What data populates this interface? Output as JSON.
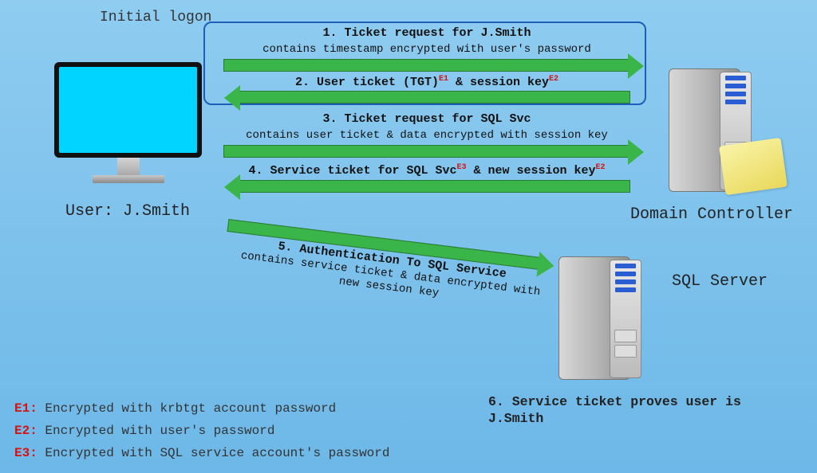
{
  "initialLogon": "Initial logon",
  "user": {
    "label": "User: J.Smith"
  },
  "dc": {
    "label": "Domain Controller"
  },
  "sql": {
    "label": "SQL Server"
  },
  "steps": {
    "s1": {
      "title": "1. Ticket request for J.Smith",
      "sub": "contains timestamp encrypted with user's password"
    },
    "s2": {
      "pre": "2. User ticket (TGT)",
      "sup1": "E1",
      "mid": "& session key",
      "sup2": "E2"
    },
    "s3": {
      "title": "3. Ticket request for SQL Svc",
      "sub": "contains user ticket & data encrypted with session key"
    },
    "s4": {
      "pre": "4. Service ticket for SQL Svc",
      "sup1": "E3",
      "mid": "& new session key",
      "sup2": "E2"
    },
    "s5": {
      "title": "5. Authentication To SQL Service",
      "sub": "contains service ticket & data encrypted with new session key"
    },
    "s6": "6. Service ticket proves user is J.Smith"
  },
  "legend": {
    "e1": {
      "key": "E1:",
      "text": " Encrypted with krbtgt account password"
    },
    "e2": {
      "key": "E2:",
      "text": " Encrypted with user's password"
    },
    "e3": {
      "key": "E3:",
      "text": " Encrypted with SQL service account's password"
    }
  }
}
